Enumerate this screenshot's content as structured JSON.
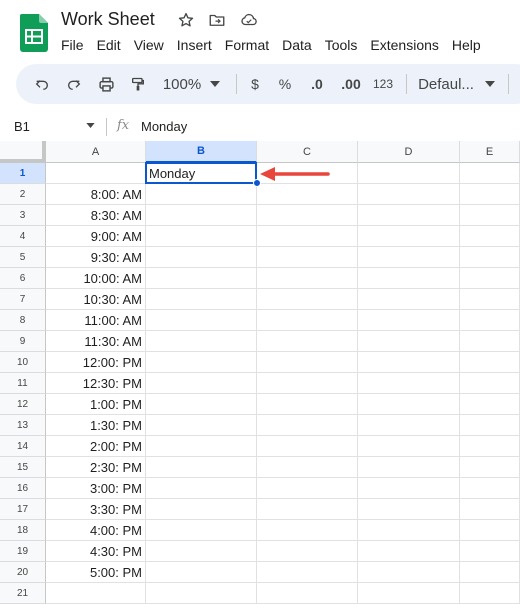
{
  "app": {
    "document_title": "Work Sheet",
    "brand_color": "#0f9d58",
    "accent_color": "#0b57d0",
    "arrow_color": "#e8453c"
  },
  "menu": [
    "File",
    "Edit",
    "View",
    "Insert",
    "Format",
    "Data",
    "Tools",
    "Extensions",
    "Help"
  ],
  "toolbar": {
    "zoom": "100%",
    "currency": "$",
    "percent": "%",
    "decrease_decimal": ".0",
    "increase_decimal": ".00",
    "number_format": "123",
    "font": "Defaul..."
  },
  "formula_bar": {
    "cell_ref": "B1",
    "fx_label": "fx",
    "value": "Monday"
  },
  "sheet": {
    "columns": [
      "A",
      "B",
      "C",
      "D",
      "E"
    ],
    "active_column": "B",
    "active_row": 1,
    "rows": [
      {
        "num": "1",
        "a": "",
        "b": "Monday"
      },
      {
        "num": "2",
        "a": "8:00: AM",
        "b": ""
      },
      {
        "num": "3",
        "a": "8:30: AM",
        "b": ""
      },
      {
        "num": "4",
        "a": "9:00: AM",
        "b": ""
      },
      {
        "num": "5",
        "a": "9:30: AM",
        "b": ""
      },
      {
        "num": "6",
        "a": "10:00: AM",
        "b": ""
      },
      {
        "num": "7",
        "a": "10:30: AM",
        "b": ""
      },
      {
        "num": "8",
        "a": "11:00: AM",
        "b": ""
      },
      {
        "num": "9",
        "a": "11:30: AM",
        "b": ""
      },
      {
        "num": "10",
        "a": "12:00: PM",
        "b": ""
      },
      {
        "num": "11",
        "a": "12:30: PM",
        "b": ""
      },
      {
        "num": "12",
        "a": "1:00: PM",
        "b": ""
      },
      {
        "num": "13",
        "a": "1:30: PM",
        "b": ""
      },
      {
        "num": "14",
        "a": "2:00: PM",
        "b": ""
      },
      {
        "num": "15",
        "a": "2:30: PM",
        "b": ""
      },
      {
        "num": "16",
        "a": "3:00: PM",
        "b": ""
      },
      {
        "num": "17",
        "a": "3:30: PM",
        "b": ""
      },
      {
        "num": "18",
        "a": "4:00: PM",
        "b": ""
      },
      {
        "num": "19",
        "a": "4:30: PM",
        "b": ""
      },
      {
        "num": "20",
        "a": "5:00: PM",
        "b": ""
      },
      {
        "num": "21",
        "a": "",
        "b": ""
      }
    ]
  }
}
